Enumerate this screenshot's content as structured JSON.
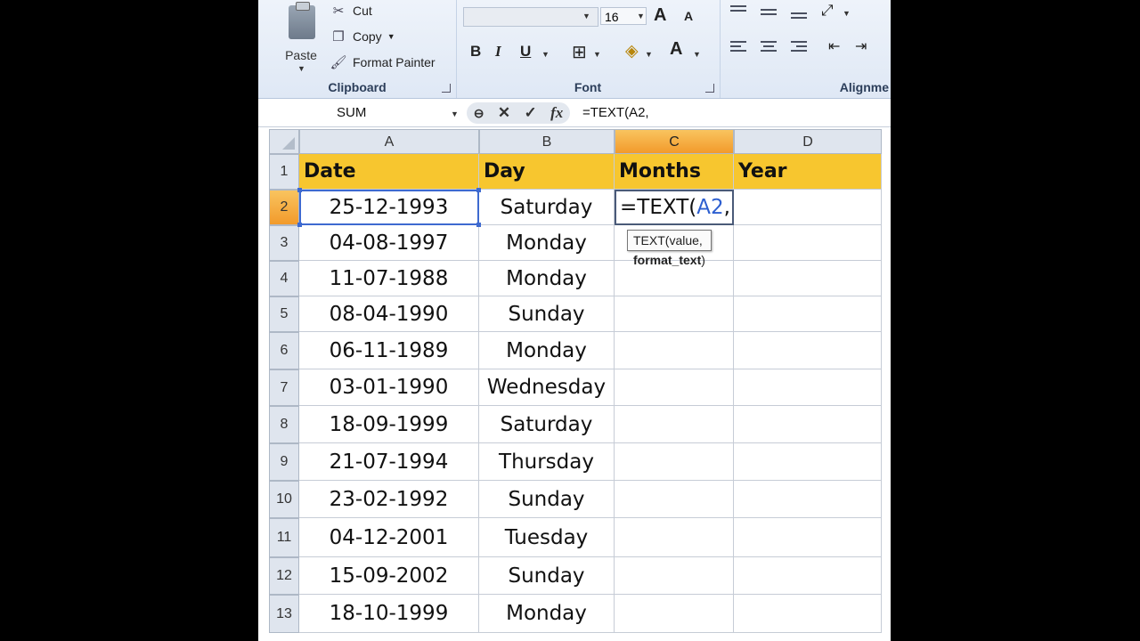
{
  "ribbon": {
    "clipboard": {
      "label": "Clipboard",
      "paste": "Paste",
      "cut": "Cut",
      "copy": "Copy",
      "format_painter": "Format Painter"
    },
    "font": {
      "label": "Font",
      "font_name": "",
      "font_size": "16",
      "grow": "A",
      "shrink": "A",
      "bold": "B",
      "italic": "I",
      "underline": "U",
      "font_color": "A"
    },
    "alignment": {
      "label": "Alignme"
    }
  },
  "formula_bar": {
    "name_box": "SUM",
    "cancel_glyph": "✕",
    "enter_glyph": "✓",
    "fx_glyph": "fx",
    "formula": "=TEXT(A2,"
  },
  "columns": [
    "A",
    "B",
    "C",
    "D"
  ],
  "rows": [
    "1",
    "2",
    "3",
    "4",
    "5",
    "6",
    "7",
    "8",
    "9",
    "10",
    "11",
    "12",
    "13"
  ],
  "headers": {
    "date": "Date",
    "day": "Day",
    "months": "Months",
    "year": "Year"
  },
  "data": [
    {
      "date": "25-12-1993",
      "day": "Saturday"
    },
    {
      "date": "04-08-1997",
      "day": "Monday"
    },
    {
      "date": "11-07-1988",
      "day": "Monday"
    },
    {
      "date": "08-04-1990",
      "day": "Sunday"
    },
    {
      "date": "06-11-1989",
      "day": "Monday"
    },
    {
      "date": "03-01-1990",
      "day": "Wednesday"
    },
    {
      "date": "18-09-1999",
      "day": "Saturday"
    },
    {
      "date": "21-07-1994",
      "day": "Thursday"
    },
    {
      "date": "23-02-1992",
      "day": "Sunday"
    },
    {
      "date": "04-12-2001",
      "day": "Tuesday"
    },
    {
      "date": "15-09-2002",
      "day": "Sunday"
    },
    {
      "date": "18-10-1999",
      "day": "Monday"
    }
  ],
  "editing": {
    "prefix": "=TEXT(",
    "ref": "A2",
    "suffix": ","
  },
  "tooltip": {
    "fn": "TEXT(value, ",
    "arg": "format_text",
    "close": ")"
  },
  "colors": {
    "header_fill": "#f7c62f",
    "active_header": "#f29a2b",
    "ref_blue": "#2d5fd0"
  }
}
